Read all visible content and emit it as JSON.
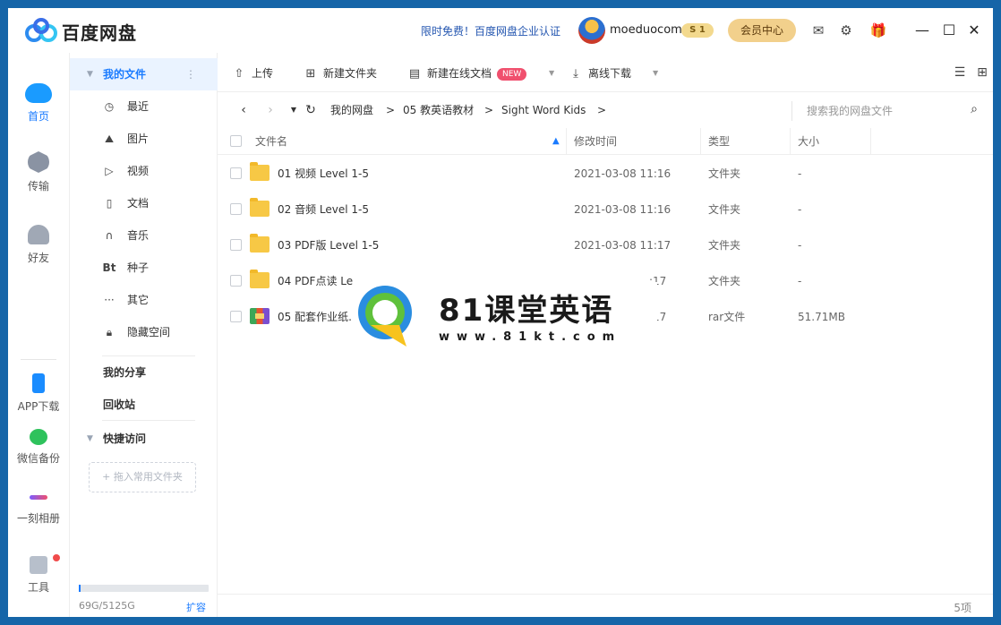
{
  "app": {
    "title": "百度网盘",
    "promo": "限时免费！百度网盘企业认证",
    "username": "moeduocom",
    "vip_level": "1",
    "member_center": "会员中心"
  },
  "left_nav": [
    {
      "label": "首页",
      "icon": "cloud-icon",
      "active": true
    },
    {
      "label": "传输",
      "icon": "transfer-icon"
    },
    {
      "label": "好友",
      "icon": "friends-icon"
    },
    {
      "label": "APP下载",
      "icon": "phone-icon"
    },
    {
      "label": "微信备份",
      "icon": "wechat-icon"
    },
    {
      "label": "一刻相册",
      "icon": "album-icon"
    },
    {
      "label": "工具",
      "icon": "tools-icon"
    }
  ],
  "sidebar": {
    "my_files": "我的文件",
    "categories": [
      {
        "label": "最近",
        "icon": "clock-icon"
      },
      {
        "label": "图片",
        "icon": "image-icon"
      },
      {
        "label": "视频",
        "icon": "play-icon"
      },
      {
        "label": "文档",
        "icon": "document-icon"
      },
      {
        "label": "音乐",
        "icon": "headphones-icon"
      },
      {
        "label": "种子",
        "icon": "bt-icon"
      },
      {
        "label": "其它",
        "icon": "more-icon"
      },
      {
        "label": "隐藏空间",
        "icon": "lock-icon"
      }
    ],
    "my_share": "我的分享",
    "recycle_bin": "回收站",
    "quick_access": "快捷访问",
    "drop_hint": "+ 拖入常用文件夹",
    "storage_text": "69G/5125G",
    "storage_used_fraction": 0.0135,
    "expand": "扩容"
  },
  "toolbar": {
    "upload": "上传",
    "new_folder": "新建文件夹",
    "new_online_doc": "新建在线文档",
    "new_badge": "NEW",
    "offline_download": "离线下载"
  },
  "breadcrumb": [
    "我的网盘",
    "05 教英语教材",
    "Sight Word Kids"
  ],
  "search": {
    "placeholder": "搜索我的网盘文件"
  },
  "table": {
    "headers": {
      "name": "文件名",
      "modified": "修改时间",
      "type": "类型",
      "size": "大小"
    },
    "rows": [
      {
        "name": "01 视频 Level 1-5",
        "modified": "2021-03-08 11:16",
        "type": "文件夹",
        "size": "-",
        "kind": "folder"
      },
      {
        "name": "02 音频 Level 1-5",
        "modified": "2021-03-08 11:16",
        "type": "文件夹",
        "size": "-",
        "kind": "folder"
      },
      {
        "name": "03 PDF版 Level 1-5",
        "modified": "2021-03-08 11:17",
        "type": "文件夹",
        "size": "-",
        "kind": "folder"
      },
      {
        "name": "04 PDF点读 Le",
        "modified": ":17",
        "type": "文件夹",
        "size": "-",
        "kind": "folder"
      },
      {
        "name": "05 配套作业纸.",
        "modified": ":17",
        "type": "rar文件",
        "size": "51.71MB",
        "kind": "rar"
      }
    ]
  },
  "footer": {
    "count": "5项"
  },
  "watermark": {
    "title": "81课堂英语",
    "url": "www.81kt.com"
  },
  "colors": {
    "accent": "#1a7bff",
    "folder": "#f7c845",
    "member": "#f2d08c",
    "badge": "#f0506e"
  }
}
